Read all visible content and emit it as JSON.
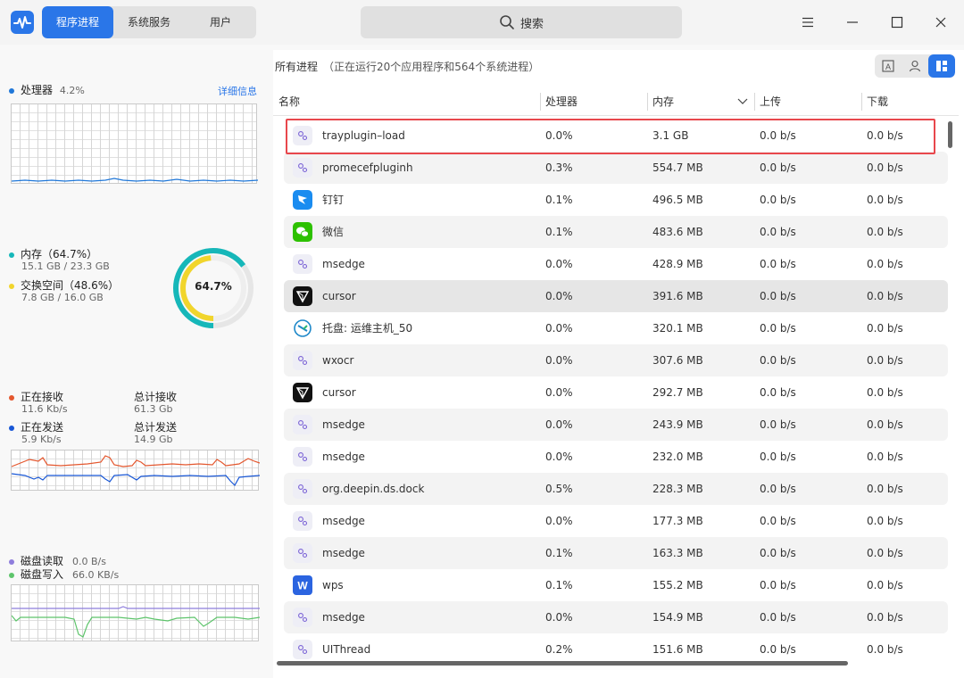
{
  "header": {
    "tabs": [
      {
        "label": "程序进程",
        "active": true
      },
      {
        "label": "系统服务",
        "active": false
      },
      {
        "label": "用户",
        "active": false
      }
    ],
    "search_label": "搜索",
    "accent": "#2a76e8"
  },
  "cpu": {
    "label": "处理器",
    "value": "4.2%",
    "detail_link": "详细信息",
    "color": "#1f77d8"
  },
  "memory": {
    "mem_label": "内存（64.7%）",
    "mem_value": "15.1 GB  /  23.3 GB",
    "swap_label": "交换空间（48.6%）",
    "swap_value": "7.8 GB  /  16.0 GB",
    "ring_text": "64.7%",
    "mem_percent": 64.7,
    "swap_percent": 48.6,
    "mem_color": "#16b7b9",
    "swap_color": "#f1d52c"
  },
  "network": {
    "recv_label": "正在接收",
    "recv_value": "11.6  Kb/s",
    "total_recv_label": "总计接收",
    "total_recv_value": "61.3  Gb",
    "send_label": "正在发送",
    "send_value": "5.9  Kb/s",
    "total_send_label": "总计发送",
    "total_send_value": "14.9  Gb",
    "recv_color": "#e4572e",
    "send_color": "#1857d6"
  },
  "disk": {
    "read_label": "磁盘读取",
    "read_value": "0.0  B/s",
    "write_label": "磁盘写入",
    "write_value": "66.0  KB/s",
    "read_color": "#8e7ddc",
    "write_color": "#5dc46b"
  },
  "summary": {
    "title": "所有进程",
    "subtitle": "（正在运行20个应用程序和564个系统进程）"
  },
  "table": {
    "columns": [
      "名称",
      "处理器",
      "内存",
      "上传",
      "下载"
    ],
    "rows": [
      {
        "name": "trayplugin–load",
        "icon": "gear-icon",
        "cpu": "0.0%",
        "mem": "3.1  GB",
        "up": "0.0  b/s",
        "down": "0.0  b/s"
      },
      {
        "name": "promecefpluginh",
        "icon": "gear-icon",
        "cpu": "0.3%",
        "mem": "554.7  MB",
        "up": "0.0  b/s",
        "down": "0.0  b/s"
      },
      {
        "name": "钉钉",
        "icon": "dingtalk-icon",
        "cpu": "0.1%",
        "mem": "496.5  MB",
        "up": "0.0  b/s",
        "down": "0.0  b/s"
      },
      {
        "name": "微信",
        "icon": "wechat-icon",
        "cpu": "0.1%",
        "mem": "483.6  MB",
        "up": "0.0  b/s",
        "down": "0.0  b/s"
      },
      {
        "name": "msedge",
        "icon": "gear-icon",
        "cpu": "0.0%",
        "mem": "428.9  MB",
        "up": "0.0  b/s",
        "down": "0.0  b/s"
      },
      {
        "name": "cursor",
        "icon": "cursor-icon",
        "cpu": "0.0%",
        "mem": "391.6  MB",
        "up": "0.0  b/s",
        "down": "0.0  b/s"
      },
      {
        "name": "托盘: 运维主机_50",
        "icon": "remote-icon",
        "cpu": "0.0%",
        "mem": "320.1  MB",
        "up": "0.0  b/s",
        "down": "0.0  b/s"
      },
      {
        "name": "wxocr",
        "icon": "gear-icon",
        "cpu": "0.0%",
        "mem": "307.6  MB",
        "up": "0.0  b/s",
        "down": "0.0  b/s"
      },
      {
        "name": "cursor",
        "icon": "cursor-icon",
        "cpu": "0.0%",
        "mem": "292.7  MB",
        "up": "0.0  b/s",
        "down": "0.0  b/s"
      },
      {
        "name": "msedge",
        "icon": "gear-icon",
        "cpu": "0.0%",
        "mem": "243.9  MB",
        "up": "0.0  b/s",
        "down": "0.0  b/s"
      },
      {
        "name": "msedge",
        "icon": "gear-icon",
        "cpu": "0.0%",
        "mem": "232.0  MB",
        "up": "0.0  b/s",
        "down": "0.0  b/s"
      },
      {
        "name": "org.deepin.ds.dock",
        "icon": "gear-icon",
        "cpu": "0.5%",
        "mem": "228.3  MB",
        "up": "0.0  b/s",
        "down": "0.0  b/s"
      },
      {
        "name": "msedge",
        "icon": "gear-icon",
        "cpu": "0.0%",
        "mem": "177.3  MB",
        "up": "0.0  b/s",
        "down": "0.0  b/s"
      },
      {
        "name": "msedge",
        "icon": "gear-icon",
        "cpu": "0.1%",
        "mem": "163.3  MB",
        "up": "0.0  b/s",
        "down": "0.0  b/s"
      },
      {
        "name": "wps",
        "icon": "wps-icon",
        "cpu": "0.1%",
        "mem": "155.2  MB",
        "up": "0.0  b/s",
        "down": "0.0  b/s"
      },
      {
        "name": "msedge",
        "icon": "gear-icon",
        "cpu": "0.0%",
        "mem": "154.9  MB",
        "up": "0.0  b/s",
        "down": "0.0  b/s"
      },
      {
        "name": "UIThread",
        "icon": "gear-icon",
        "cpu": "0.2%",
        "mem": "151.6  MB",
        "up": "0.0  b/s",
        "down": "0.0  b/s"
      }
    ],
    "highlight_color": "#e8474c"
  }
}
